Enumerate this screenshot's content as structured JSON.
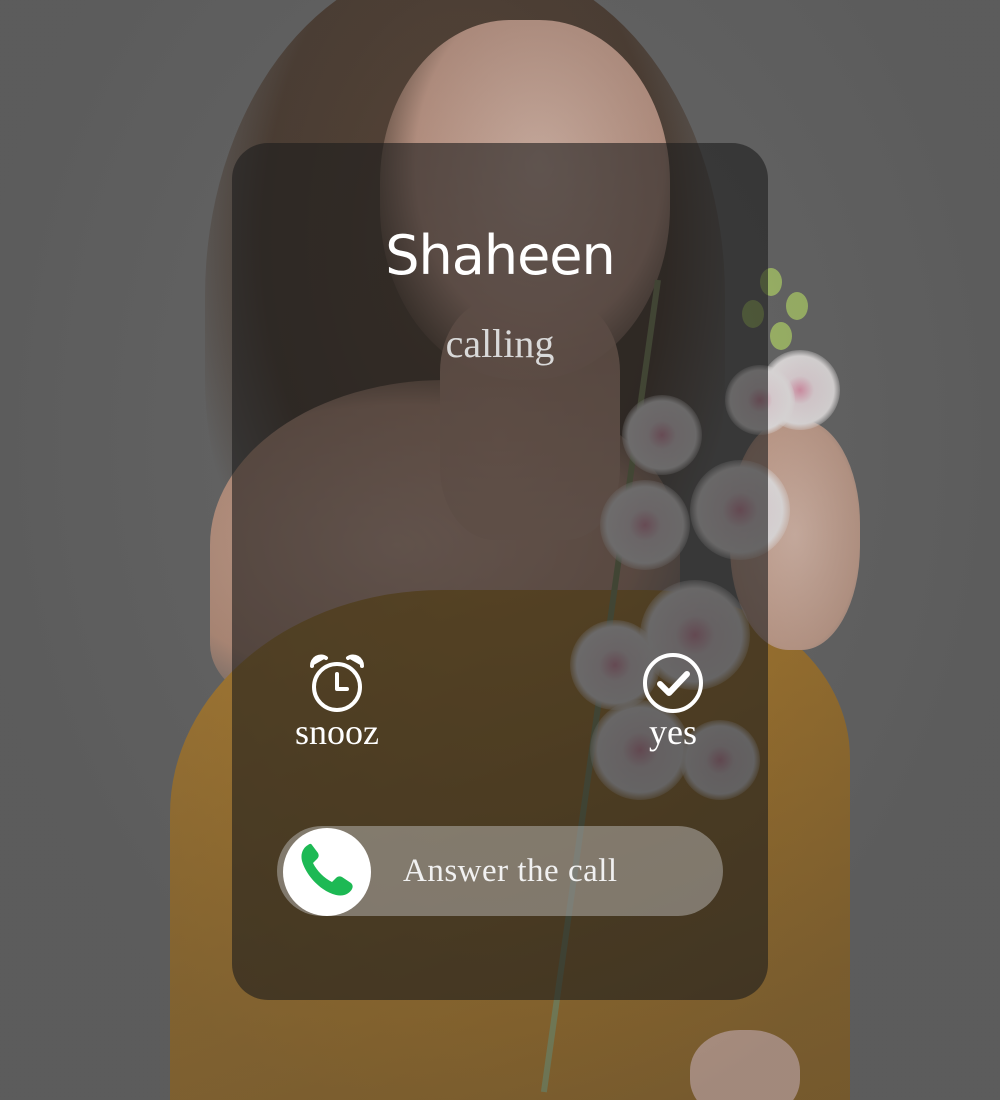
{
  "caller": {
    "name": "Shaheen",
    "status": "calling"
  },
  "actions": {
    "snooze": {
      "label": "snooz",
      "icon": "alarm-clock-icon"
    },
    "accept": {
      "label": "yes",
      "icon": "check-circle-icon"
    }
  },
  "answer_slider": {
    "label": "Answer the call",
    "icon": "phone-icon",
    "icon_color": "#1db954"
  },
  "colors": {
    "card_overlay": "rgba(28,28,28,0.6)",
    "text_primary": "#ffffff",
    "slider_track": "rgba(200,200,200,0.45)",
    "knob": "#ffffff"
  }
}
